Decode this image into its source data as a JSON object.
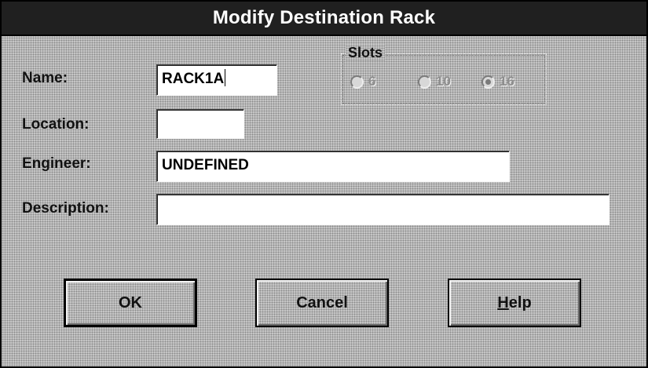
{
  "dialog": {
    "title": "Modify Destination Rack"
  },
  "fields": {
    "name": {
      "label": "Name:",
      "value": "RACK1A"
    },
    "location": {
      "label": "Location:",
      "value": ""
    },
    "engineer": {
      "label": "Engineer:",
      "value": "UNDEFINED"
    },
    "description": {
      "label": "Description:",
      "value": ""
    }
  },
  "slots": {
    "label": "Slots",
    "options": [
      {
        "label": "6",
        "checked": false
      },
      {
        "label": "10",
        "checked": false
      },
      {
        "label": "16",
        "checked": true
      }
    ],
    "selected": "16",
    "enabled": false
  },
  "buttons": {
    "ok": "OK",
    "cancel": "Cancel",
    "help_mnemonic": "H",
    "help_rest": "elp"
  }
}
